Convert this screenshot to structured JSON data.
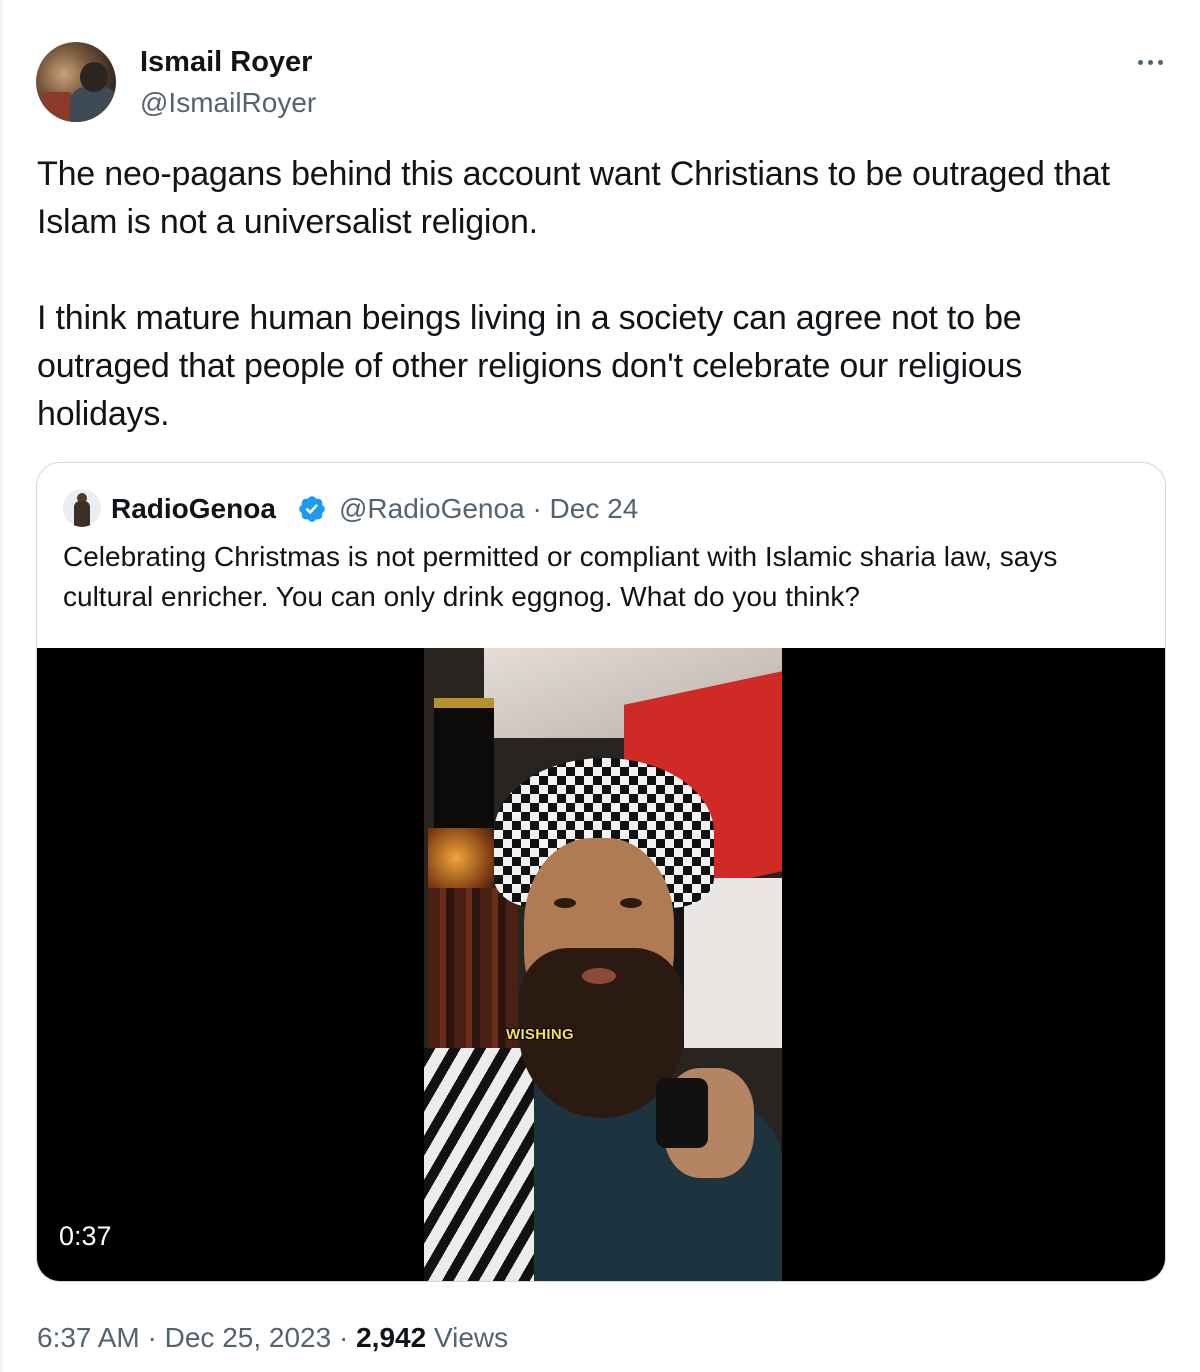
{
  "author": {
    "display_name": "Ismail Royer",
    "handle": "@IsmailRoyer"
  },
  "menu": {
    "icon": "more-horizontal-icon"
  },
  "tweet": {
    "paragraph_1": "The neo-pagans behind this account want Christians to be outraged that Islam is not a universalist religion.",
    "paragraph_2": "I think mature human beings living in a society can agree not to be outraged that people of other religions don't celebrate our religious holidays."
  },
  "quoted_tweet": {
    "display_name": "RadioGenoa",
    "verified_icon": "verified-badge-icon",
    "verified_color": "#1d9bf0",
    "handle": "@RadioGenoa",
    "separator": "·",
    "date": "Dec 24",
    "text": "Celebrating Christmas is not permitted or compliant with Islamic sharia law, says cultural enricher. You can only drink eggnog. What do you think?",
    "video": {
      "caption": "WISHING",
      "duration": "0:37"
    }
  },
  "footer": {
    "time": "6:37 AM",
    "separator": "·",
    "date": "Dec 25, 2023",
    "views_count": "2,942",
    "views_label": "Views"
  }
}
